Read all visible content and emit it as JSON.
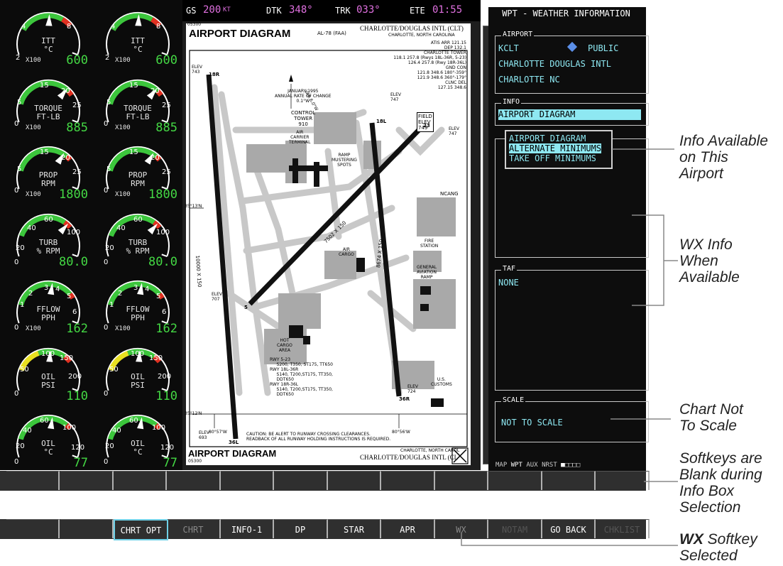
{
  "nav_bar": {
    "gs_label": "GS",
    "gs_value": "200",
    "gs_unit": "KT",
    "dtk_label": "DTK",
    "dtk_value": "348°",
    "trk_label": "TRK",
    "trk_value": "033°",
    "ete_label": "ETE",
    "ete_value": "01:55"
  },
  "engine": {
    "gauges": [
      {
        "label": "ITT\n°C",
        "mult": "X100",
        "value": "600",
        "ticks": [
          "4",
          "8",
          "2"
        ]
      },
      {
        "label": "TORQUE\nFT-LB",
        "mult": "X100",
        "value": "885",
        "ticks": [
          "15",
          "20",
          "25",
          "5",
          "0"
        ]
      },
      {
        "label": "PROP\nRPM",
        "mult": "X100",
        "value": "1800",
        "ticks": [
          "15",
          "20",
          "25",
          "5",
          "0"
        ]
      },
      {
        "label": "TURB\n% RPM",
        "mult": "",
        "value": "80.0",
        "ticks": [
          "60",
          "40",
          "100",
          "20",
          "0"
        ]
      },
      {
        "label": "FFLOW\nPPH",
        "mult": "X100",
        "value": "162",
        "ticks": [
          "3",
          "4",
          "2",
          "5",
          "1",
          "6",
          "0"
        ]
      },
      {
        "label": "OIL\nPSI",
        "mult": "",
        "value": "110",
        "ticks": [
          "100",
          "150",
          "50",
          "200",
          "0"
        ]
      },
      {
        "label": "OIL\n°C",
        "mult": "",
        "value": "77",
        "ticks": [
          "60",
          "40",
          "100",
          "20",
          "120",
          "0"
        ]
      }
    ]
  },
  "chart": {
    "code_top": "05300",
    "title": "AIRPORT DIAGRAM",
    "faa_id": "AL-78 (FAA)",
    "airport_title": "CHARLOTTE/DOUGLAS INTL (CLT)",
    "city": "CHARLOTTE, NORTH CAROLINA",
    "freq_lines": [
      "ATIS ARR 121.15",
      "DEP 132.1",
      "CHARLOTTE TOWER",
      "118.1 257.8 (Rwys 18L-36R, 5-23)",
      "126.4 257.8 (Rwy 18R-36L)",
      "GND CON",
      "121.8 348.6 180°-359°",
      "121.9 348.6 360°-179°",
      "CLNC DEL",
      "127.15 348.6"
    ],
    "elev_nw": "ELEV\n743",
    "elev_ne": "ELEV\n747",
    "elev_nc": "ELEV\n747",
    "field_elev": "FIELD\nELEV\n749",
    "elev_w": "ELEV\n707",
    "elev_se": "ELEV\n724",
    "elev_sw": "ELEV\n693",
    "var_note": "JANUARY 1995\nANNUAL RATE OF CHANGE\n0.1°W",
    "var": "VAR 6.0°W",
    "tower": "CONTROL\nTOWER\n910",
    "terminal": "AIR\nCARRIER\nTERMINAL",
    "ramp": "RAMP\nMUSTERING\nSPOTS",
    "ncang": "NCANG",
    "fire": "FIRE\nSTATION",
    "ga": "GENERAL\nAVIATION\nRAMP",
    "cargo": "AIR\nCARGO",
    "hot_cargo": "HOT\nCARGO\nAREA",
    "customs": "U.S.\nCUSTOMS",
    "rwy_note": "RWY 5-23\n     S200, T350, ST175, TT650\nRWY 18L-36R\n     S140, T200,ST175, TT350,\n     DDT650\nRWY 18R-36L\n     S140, T200,ST175, TT350,\n     DDT650",
    "lat_n": "35°13'N",
    "lat_s": "35°12'N",
    "lon_w": "80°57'W",
    "lon_e": "80°56'W",
    "rwy_len_w": "10000 X 150",
    "rwy_len_diag": "7502 X 150",
    "rwy_len_e": "8674 X 150",
    "caution": "CAUTION: BE ALERT TO RUNWAY CROSSING CLEARANCES.\nREADBACK OF ALL RUNWAY HOLDING INSTRUCTIONS IS REQUIRED.",
    "footer_title": "AIRPORT DIAGRAM",
    "footer_code": "05300",
    "footer_city": "CHARLOTTE, NORTH CAROL",
    "footer_airport": "CHARLOTTE/DOUGLAS INTL (CL",
    "rwy_labels": [
      "18R",
      "36L",
      "18L",
      "36R",
      "5",
      "23"
    ]
  },
  "weather_panel": {
    "title": "WPT - WEATHER INFORMATION",
    "airport_box_label": "AIRPORT",
    "ident": "KCLT",
    "usage": "PUBLIC",
    "name": "CHARLOTTE DOUGLAS INTL",
    "city": "CHARLOTTE NC",
    "info_box_label": "INFO",
    "info_selected": "AIRPORT DIAGRAM",
    "info_options": [
      "AIRPORT DIAGRAM",
      "ALTERNATE MINIMUMS",
      "TAKE OFF MINIMUMS"
    ],
    "taf_label": "TAF",
    "taf_value": "NONE",
    "scale_label": "SCALE",
    "scale_value": "NOT TO SCALE",
    "page_group": [
      "MAP",
      "WPT",
      "AUX",
      "NRST"
    ]
  },
  "softkeys_blank": [
    "",
    "",
    "",
    "",
    "",
    "",
    "",
    "",
    "",
    "",
    "",
    ""
  ],
  "softkeys": [
    "",
    "",
    "CHRT OPT",
    "CHRT",
    "INFO-1",
    "DP",
    "STAR",
    "APR",
    "WX",
    "NOTAM",
    "GO BACK",
    "CHKLIST"
  ],
  "callouts": {
    "info_available": "Info Available\non This\nAirport",
    "wx_info": "WX Info\nWhen\nAvailable",
    "not_scale": "Chart Not\nTo Scale",
    "softkeys_blank": "Softkeys are\nBlank during\nInfo Box\nSelection",
    "wx_softkey_bold": "WX",
    "wx_softkey_rest": " Softkey",
    "wx_softkey_line2": "Selected"
  },
  "colors": {
    "cyan": "#8ee8f2",
    "green": "#44d844",
    "magenta": "#e070e0"
  }
}
